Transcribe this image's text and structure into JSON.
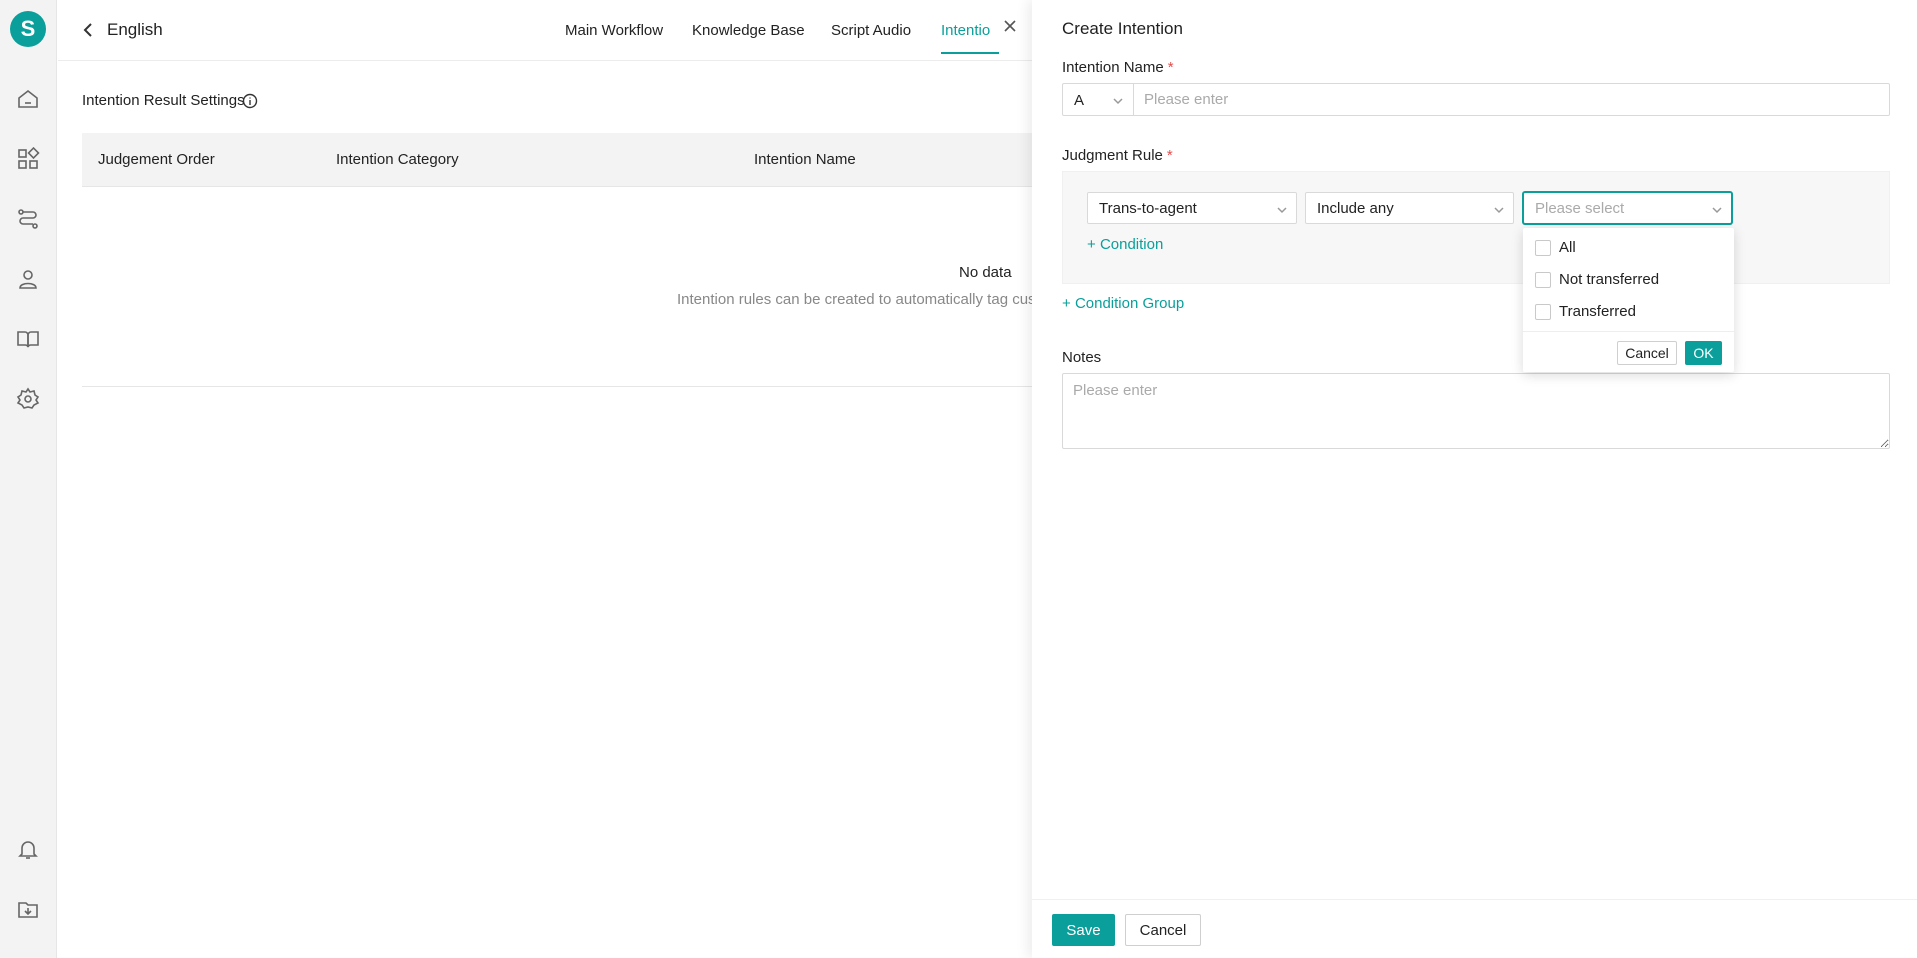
{
  "app": {
    "logo_letter": "S"
  },
  "sidebar": {
    "icons": [
      "home-icon",
      "apps-icon",
      "route-icon",
      "user-bot-icon",
      "book-icon",
      "gear-icon",
      "bell-icon",
      "download-folder-icon"
    ]
  },
  "header": {
    "title": "English",
    "tabs": [
      {
        "label": "Main Workflow"
      },
      {
        "label": "Knowledge Base"
      },
      {
        "label": "Script Audio"
      },
      {
        "label": "Intentio"
      }
    ],
    "active_tab": 3
  },
  "main": {
    "section_title": "Intention Result Settings",
    "columns": [
      "Judgement Order",
      "Intention Category",
      "Intention Name"
    ],
    "empty_title": "No data",
    "empty_desc": "Intention rules can be created to automatically tag cust"
  },
  "drawer": {
    "title": "Create Intention",
    "name_label": "Intention Name",
    "required_mark": "*",
    "name_prefix": "A",
    "name_placeholder": "Please enter",
    "rule_label": "Judgment Rule",
    "field_select": "Trans-to-agent",
    "operator_select": "Include any",
    "value_placeholder": "Please select",
    "add_condition": "Condition",
    "add_condition_group": "Condition Group",
    "notes_label": "Notes",
    "notes_placeholder": "Please enter",
    "save_label": "Save",
    "cancel_label": "Cancel"
  },
  "dropdown": {
    "options": [
      {
        "label": "All",
        "checked": false
      },
      {
        "label": "Not transferred",
        "checked": false
      },
      {
        "label": "Transferred",
        "checked": false
      }
    ],
    "cancel_label": "Cancel",
    "ok_label": "OK"
  },
  "colors": {
    "accent": "#0a9f9b",
    "required": "#e34d4d"
  }
}
